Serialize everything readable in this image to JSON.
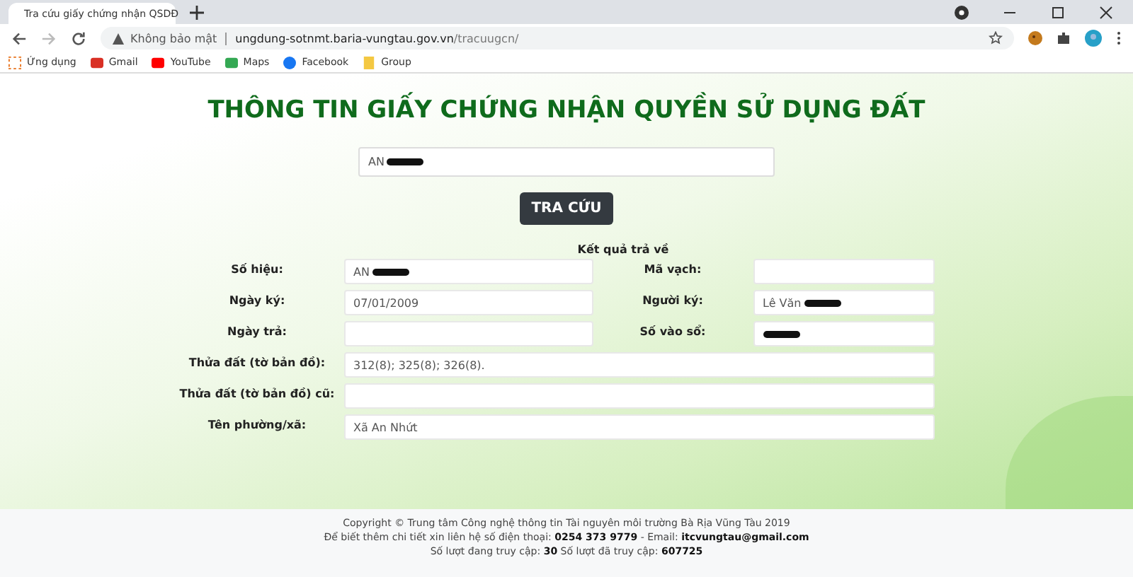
{
  "browser": {
    "tab_title": "Tra cứu giấy chứng nhận QSDĐ",
    "security_label": "Không bảo mật",
    "url_host": "ungdung-sotnmt.baria-vungtau.gov.vn",
    "url_path": "/tracuugcn/",
    "bookmarks": [
      {
        "label": "Ứng dụng",
        "kind": "apps"
      },
      {
        "label": "Gmail",
        "kind": "gmail"
      },
      {
        "label": "YouTube",
        "kind": "youtube"
      },
      {
        "label": "Maps",
        "kind": "maps"
      },
      {
        "label": "Facebook",
        "kind": "facebook"
      },
      {
        "label": "Group",
        "kind": "folder"
      }
    ]
  },
  "page": {
    "title": "THÔNG TIN GIẤY CHỨNG NHẬN QUYỀN SỬ DỤNG ĐẤT",
    "search": {
      "value": "AN",
      "redacted": true
    },
    "search_button": "TRA CỨU",
    "result_heading": "Kết quả trả về",
    "rows": [
      {
        "kind": "pair",
        "fields": [
          {
            "label": "Số hiệu:",
            "value": "AN",
            "redacted": true
          },
          {
            "label": "Mã vạch:",
            "redacted": false
          }
        ]
      },
      {
        "kind": "pair",
        "fields": [
          {
            "label": "Ngày ký:",
            "value": "07/01/2009",
            "redacted": false
          },
          {
            "label": "Người ký:",
            "value": "Lê Văn",
            "redacted": true
          }
        ]
      },
      {
        "kind": "pair",
        "fields": [
          {
            "label": "Ngày trả:",
            "redacted": false
          },
          {
            "label": "Số vào sổ:",
            "redacted": true
          }
        ]
      },
      {
        "kind": "wide",
        "fields": [
          {
            "label": "Thửa đất (tờ bản đồ):",
            "value": "312(8); 325(8); 326(8).",
            "redacted": false
          }
        ]
      },
      {
        "kind": "wide",
        "fields": [
          {
            "label": "Thửa đất (tờ bản đồ) cũ:",
            "redacted": false
          }
        ]
      },
      {
        "kind": "wide",
        "fields": [
          {
            "label": "Tên phường/xã:",
            "value": "Xã An Nhứt",
            "redacted": false
          }
        ]
      }
    ]
  },
  "footer": [
    "Copyright © Trung tâm Công nghệ thông tin Tài nguyên môi trường Bà Rịa Vũng Tàu 2019",
    "Để biết thêm chi tiết xin liên hệ số điện thoại: **0254 373 9779** - Email: **itcvungtau@gmail.com**",
    "Số lượt đang truy cập: **30** Số lượt đã truy cập: **607725**"
  ]
}
